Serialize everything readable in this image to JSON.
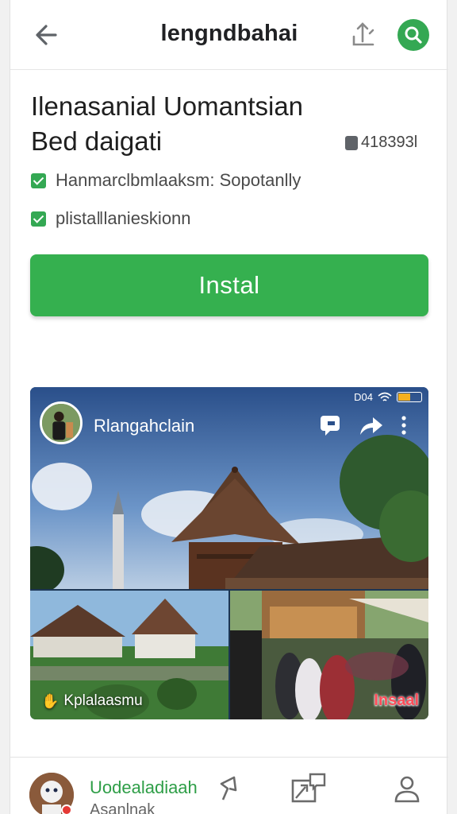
{
  "header": {
    "title": "lengndbahai",
    "back_icon": "arrow-left-icon",
    "share_icon": "share-icon",
    "search_icon": "search-icon",
    "accent": "#34a853"
  },
  "app": {
    "title_line1": "Ilenasanial Uomantsian",
    "title_line2": "Bed daigati",
    "size": "418393l",
    "features": [
      "Hanmarclbmlaaksm: Sopotanlly",
      "plistaǁlanieskionn"
    ],
    "install_label": "Instal",
    "install_color": "#35b04f"
  },
  "preview": {
    "channel_name": "Rlangahclain",
    "status_text": "D04",
    "left_caption": "Kplalaasmu",
    "right_caption": "Insaal"
  },
  "bottom_bar": {
    "name": "Uodealadiaah",
    "sub": "Asanlnak",
    "icons": [
      "pin-icon",
      "image-chat-icon",
      "person-icon"
    ]
  }
}
